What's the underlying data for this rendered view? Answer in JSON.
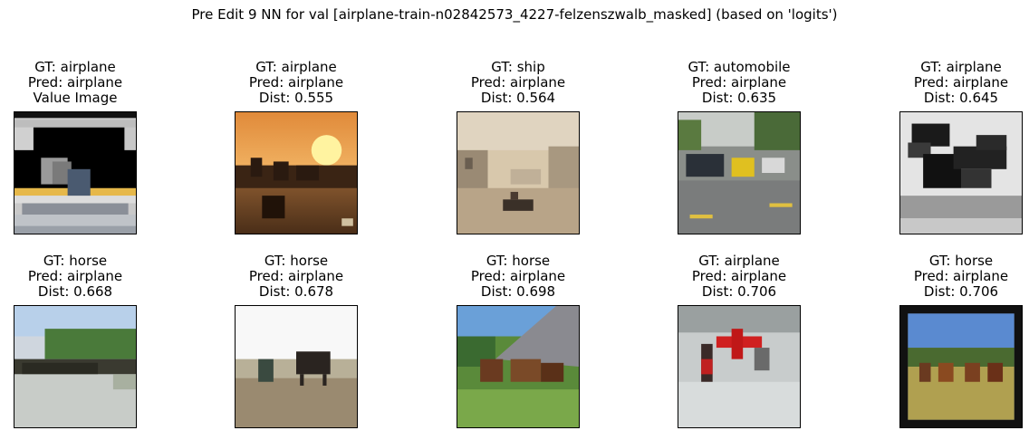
{
  "figure": {
    "suptitle": "Pre Edit 9 NN for val [airplane-train-n02842573_4227-felzenszwalb_masked] (based on 'logits')"
  },
  "panels": [
    {
      "gt": "GT: airplane",
      "pred": "Pred: airplane",
      "extra": "Value Image"
    },
    {
      "gt": "GT: airplane",
      "pred": "Pred: airplane",
      "extra": "Dist: 0.555"
    },
    {
      "gt": "GT: ship",
      "pred": "Pred: airplane",
      "extra": "Dist: 0.564"
    },
    {
      "gt": "GT: automobile",
      "pred": "Pred: airplane",
      "extra": "Dist: 0.635"
    },
    {
      "gt": "GT: airplane",
      "pred": "Pred: airplane",
      "extra": "Dist: 0.645"
    },
    {
      "gt": "GT: horse",
      "pred": "Pred: airplane",
      "extra": "Dist: 0.668"
    },
    {
      "gt": "GT: horse",
      "pred": "Pred: airplane",
      "extra": "Dist: 0.678"
    },
    {
      "gt": "GT: horse",
      "pred": "Pred: airplane",
      "extra": "Dist: 0.698"
    },
    {
      "gt": "GT: airplane",
      "pred": "Pred: airplane",
      "extra": "Dist: 0.706"
    },
    {
      "gt": "GT: horse",
      "pred": "Pred: airplane",
      "extra": "Dist: 0.706"
    }
  ]
}
